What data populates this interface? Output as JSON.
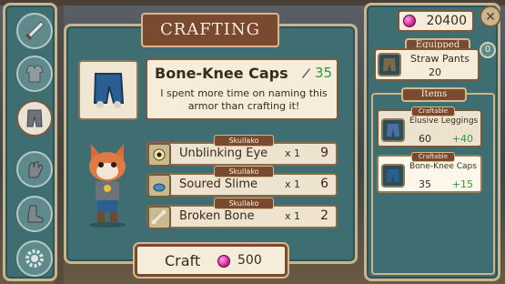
{
  "currency": {
    "amount": "20400"
  },
  "header": {
    "title": "CRAFTING"
  },
  "close_button": {
    "glyph": "✕"
  },
  "sidebar": {
    "tabs": [
      {
        "name": "weapon-tab",
        "icon": "sword-icon",
        "active": false
      },
      {
        "name": "chest-tab",
        "icon": "armor-icon",
        "active": false
      },
      {
        "name": "legs-tab",
        "icon": "pants-icon",
        "active": true
      },
      {
        "name": "hands-tab",
        "icon": "glove-icon",
        "active": false
      },
      {
        "name": "feet-tab",
        "icon": "boot-icon",
        "active": false
      },
      {
        "name": "accessory-tab",
        "icon": "gear-icon",
        "active": false
      }
    ]
  },
  "item": {
    "name": "Bone-Knee Caps",
    "stat": "35",
    "stat_icon": "sword-stat-icon",
    "description": "I spent more time on naming this armor than crafting it!"
  },
  "materials": [
    {
      "source": "Skullako",
      "name": "Unblinking Eye",
      "qty": "x 1",
      "have": "9"
    },
    {
      "source": "Skullako",
      "name": "Soured Slime",
      "qty": "x 1",
      "have": "6"
    },
    {
      "source": "Skullako",
      "name": "Broken Bone",
      "qty": "x 1",
      "have": "2"
    }
  ],
  "craft_button": {
    "label": "Craft",
    "cost": "500"
  },
  "equipped": {
    "header": "Equipped",
    "badge": "0",
    "item_name": "Straw Pants",
    "item_stat": "20"
  },
  "items_section": {
    "header": "Items",
    "list": [
      {
        "tag": "Craftable",
        "name": "Elusive Leggings",
        "stat": "60",
        "delta": "+40",
        "selected": false
      },
      {
        "tag": "Craftable",
        "name": "Bone-Knee Caps",
        "stat": "35",
        "delta": "+15",
        "selected": true
      }
    ]
  },
  "colors": {
    "panel": "#3e6e72",
    "paper": "#f5ecd9",
    "ribbon": "#7a4a30",
    "positive": "#2e9a3a",
    "gem": "#d1288f"
  }
}
